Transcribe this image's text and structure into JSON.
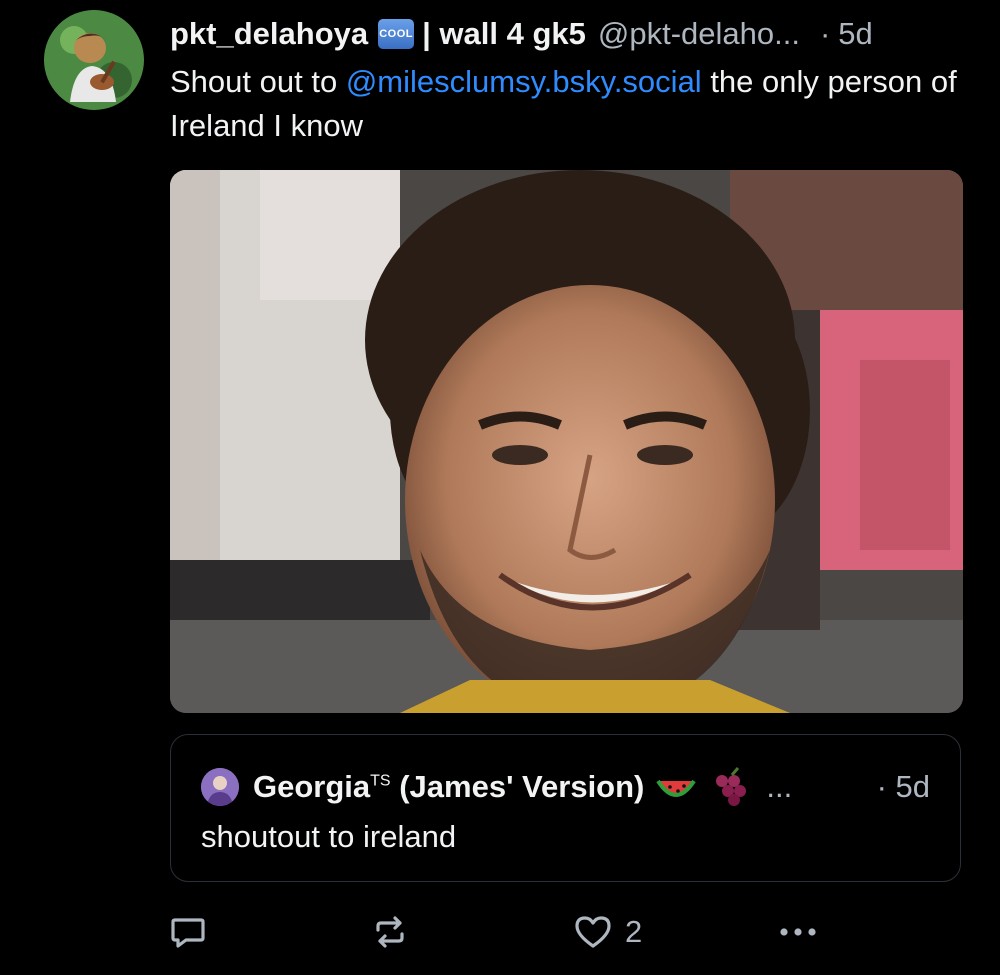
{
  "post": {
    "display_name": "pkt_delahoya",
    "badge_icon": "cool-button-emoji",
    "badge_text": "COOL",
    "wall_text": "| wall 4 gk5",
    "handle": "@pkt-delaho...",
    "separator": "·",
    "time": "5d",
    "text_before": "Shout out to ",
    "mention": "@milesclumsy.bsky.social",
    "text_after": " the only person of Ireland I know",
    "colors": {
      "mention": "#2f8cff",
      "muted": "#aeb6c0",
      "text": "#f1f3f5",
      "background": "#000000"
    }
  },
  "quote": {
    "name": "Georgia",
    "name_superscript": "TS",
    "name_suffix": " (James' Version)",
    "emoji_icons": [
      "watermelon-emoji",
      "grapes-emoji"
    ],
    "ellipsis": "...",
    "separator": "·",
    "time": "5d",
    "text": "shoutout to ireland"
  },
  "actions": {
    "reply_icon": "reply-icon",
    "repost_icon": "repost-icon",
    "like_icon": "heart-icon",
    "like_count": "2",
    "more_icon": "more-icon"
  }
}
